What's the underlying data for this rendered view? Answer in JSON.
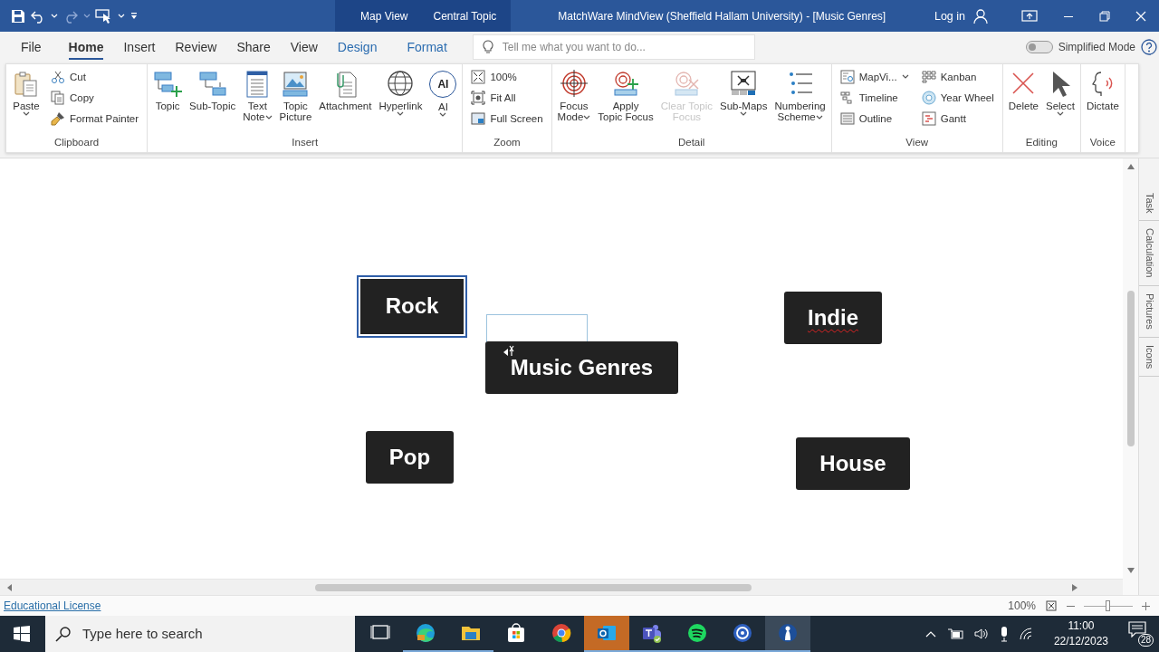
{
  "title_bar": {
    "context_tabs": [
      "Map View",
      "Central Topic"
    ],
    "title": "MatchWare MindView (Sheffield Hallam University) - [Music Genres]",
    "login": "Log in"
  },
  "menu_tabs": [
    {
      "label": "File",
      "selected": false,
      "kind": "plain"
    },
    {
      "label": "Home",
      "selected": true,
      "kind": "plain"
    },
    {
      "label": "Insert",
      "selected": false,
      "kind": "plain"
    },
    {
      "label": "Review",
      "selected": false,
      "kind": "plain"
    },
    {
      "label": "Share",
      "selected": false,
      "kind": "plain"
    },
    {
      "label": "View",
      "selected": false,
      "kind": "plain"
    },
    {
      "label": "Design",
      "selected": false,
      "kind": "contextual"
    },
    {
      "label": "Format",
      "selected": false,
      "kind": "contextual"
    }
  ],
  "search": {
    "placeholder": "Tell me what you want to do..."
  },
  "simplified_mode": {
    "label": "Simplified Mode",
    "on": false
  },
  "ribbon": {
    "groups": [
      {
        "label": "Clipboard",
        "items": [
          {
            "kind": "large",
            "lines": [
              "Paste"
            ],
            "dropdown": true,
            "disabled": false
          },
          {
            "kind": "small",
            "lines": [
              "Cut"
            ],
            "dropdown": false,
            "disabled": false
          },
          {
            "kind": "small",
            "lines": [
              "Copy"
            ],
            "dropdown": false,
            "disabled": false
          },
          {
            "kind": "small",
            "lines": [
              "Format Painter"
            ],
            "dropdown": false,
            "disabled": false
          }
        ]
      },
      {
        "label": "Insert",
        "items": [
          {
            "kind": "large",
            "lines": [
              "Topic"
            ],
            "dropdown": false,
            "disabled": false
          },
          {
            "kind": "large",
            "lines": [
              "Sub-Topic"
            ],
            "dropdown": false,
            "disabled": false
          },
          {
            "kind": "large",
            "lines": [
              "Text",
              "Note"
            ],
            "dropdown": true,
            "disabled": false
          },
          {
            "kind": "large",
            "lines": [
              "Topic",
              "Picture"
            ],
            "dropdown": false,
            "disabled": false
          },
          {
            "kind": "large",
            "lines": [
              "Attachment"
            ],
            "dropdown": false,
            "disabled": false
          },
          {
            "kind": "large",
            "lines": [
              "Hyperlink"
            ],
            "dropdown": true,
            "disabled": false
          },
          {
            "kind": "badge",
            "badge": "AI",
            "lines": [
              "AI"
            ],
            "dropdown": true,
            "disabled": false
          }
        ]
      },
      {
        "label": "Zoom",
        "items": [
          {
            "kind": "small",
            "lines": [
              "100%"
            ],
            "dropdown": false,
            "disabled": false
          },
          {
            "kind": "small",
            "lines": [
              "Fit All"
            ],
            "dropdown": false,
            "disabled": false
          },
          {
            "kind": "small",
            "lines": [
              "Full Screen"
            ],
            "dropdown": false,
            "disabled": false
          }
        ]
      },
      {
        "label": "Detail",
        "items": [
          {
            "kind": "large",
            "lines": [
              "Focus",
              "Mode"
            ],
            "dropdown": true,
            "disabled": false
          },
          {
            "kind": "large",
            "lines": [
              "Apply",
              "Topic Focus"
            ],
            "dropdown": false,
            "disabled": false
          },
          {
            "kind": "large",
            "lines": [
              "Clear Topic",
              "Focus"
            ],
            "dropdown": false,
            "disabled": true
          },
          {
            "kind": "large",
            "lines": [
              "Sub-Maps"
            ],
            "dropdown": true,
            "disabled": false
          },
          {
            "kind": "large",
            "lines": [
              "Numbering",
              "Scheme"
            ],
            "dropdown": true,
            "disabled": false
          }
        ]
      },
      {
        "label": "View",
        "items": [
          {
            "kind": "small",
            "lines": [
              "MapVi..."
            ],
            "dropdown": true,
            "disabled": false
          },
          {
            "kind": "small",
            "lines": [
              "Timeline"
            ],
            "dropdown": false,
            "disabled": false
          },
          {
            "kind": "small",
            "lines": [
              "Outline"
            ],
            "dropdown": false,
            "disabled": false
          },
          {
            "kind": "small",
            "lines": [
              "Kanban"
            ],
            "dropdown": false,
            "disabled": false
          },
          {
            "kind": "small",
            "lines": [
              "Year Wheel"
            ],
            "dropdown": false,
            "disabled": false
          },
          {
            "kind": "small",
            "lines": [
              "Gantt"
            ],
            "dropdown": false,
            "disabled": false
          }
        ]
      },
      {
        "label": "Editing",
        "items": [
          {
            "kind": "large",
            "lines": [
              "Delete"
            ],
            "dropdown": false,
            "disabled": false
          },
          {
            "kind": "large",
            "lines": [
              "Select"
            ],
            "dropdown": true,
            "disabled": false
          }
        ]
      },
      {
        "label": "Voice",
        "items": [
          {
            "kind": "large",
            "lines": [
              "Dictate"
            ],
            "dropdown": false,
            "disabled": false
          }
        ]
      }
    ]
  },
  "map": {
    "nodes": [
      {
        "text": "Rock",
        "selected": true,
        "misspelled": false
      },
      {
        "text": "Music Genres",
        "selected": false,
        "misspelled": false
      },
      {
        "text": "Indie",
        "selected": false,
        "misspelled": true
      },
      {
        "text": "Pop",
        "selected": false,
        "misspelled": false
      },
      {
        "text": "House",
        "selected": false,
        "misspelled": false
      }
    ]
  },
  "side_tabs": [
    "Task",
    "Calculation",
    "Pictures",
    "Icons"
  ],
  "status_bar": {
    "license": "Educational License",
    "zoom": "100%",
    "zoom_slider": {
      "level": 0.5
    }
  },
  "taskbar": {
    "search_placeholder": "Type here to search",
    "apps": [
      {
        "running": false,
        "selected": false,
        "flashing": false
      },
      {
        "running": true,
        "selected": false,
        "flashing": false
      },
      {
        "running": true,
        "selected": false,
        "flashing": false
      },
      {
        "running": false,
        "selected": false,
        "flashing": false
      },
      {
        "running": false,
        "selected": false,
        "flashing": false
      },
      {
        "running": true,
        "selected": false,
        "flashing": true
      },
      {
        "running": true,
        "selected": false,
        "flashing": false
      },
      {
        "running": true,
        "selected": false,
        "flashing": false
      },
      {
        "running": true,
        "selected": false,
        "flashing": false
      },
      {
        "running": true,
        "selected": true,
        "flashing": false
      }
    ],
    "time": "11:00",
    "date": "22/12/2023",
    "notifications": "28"
  }
}
